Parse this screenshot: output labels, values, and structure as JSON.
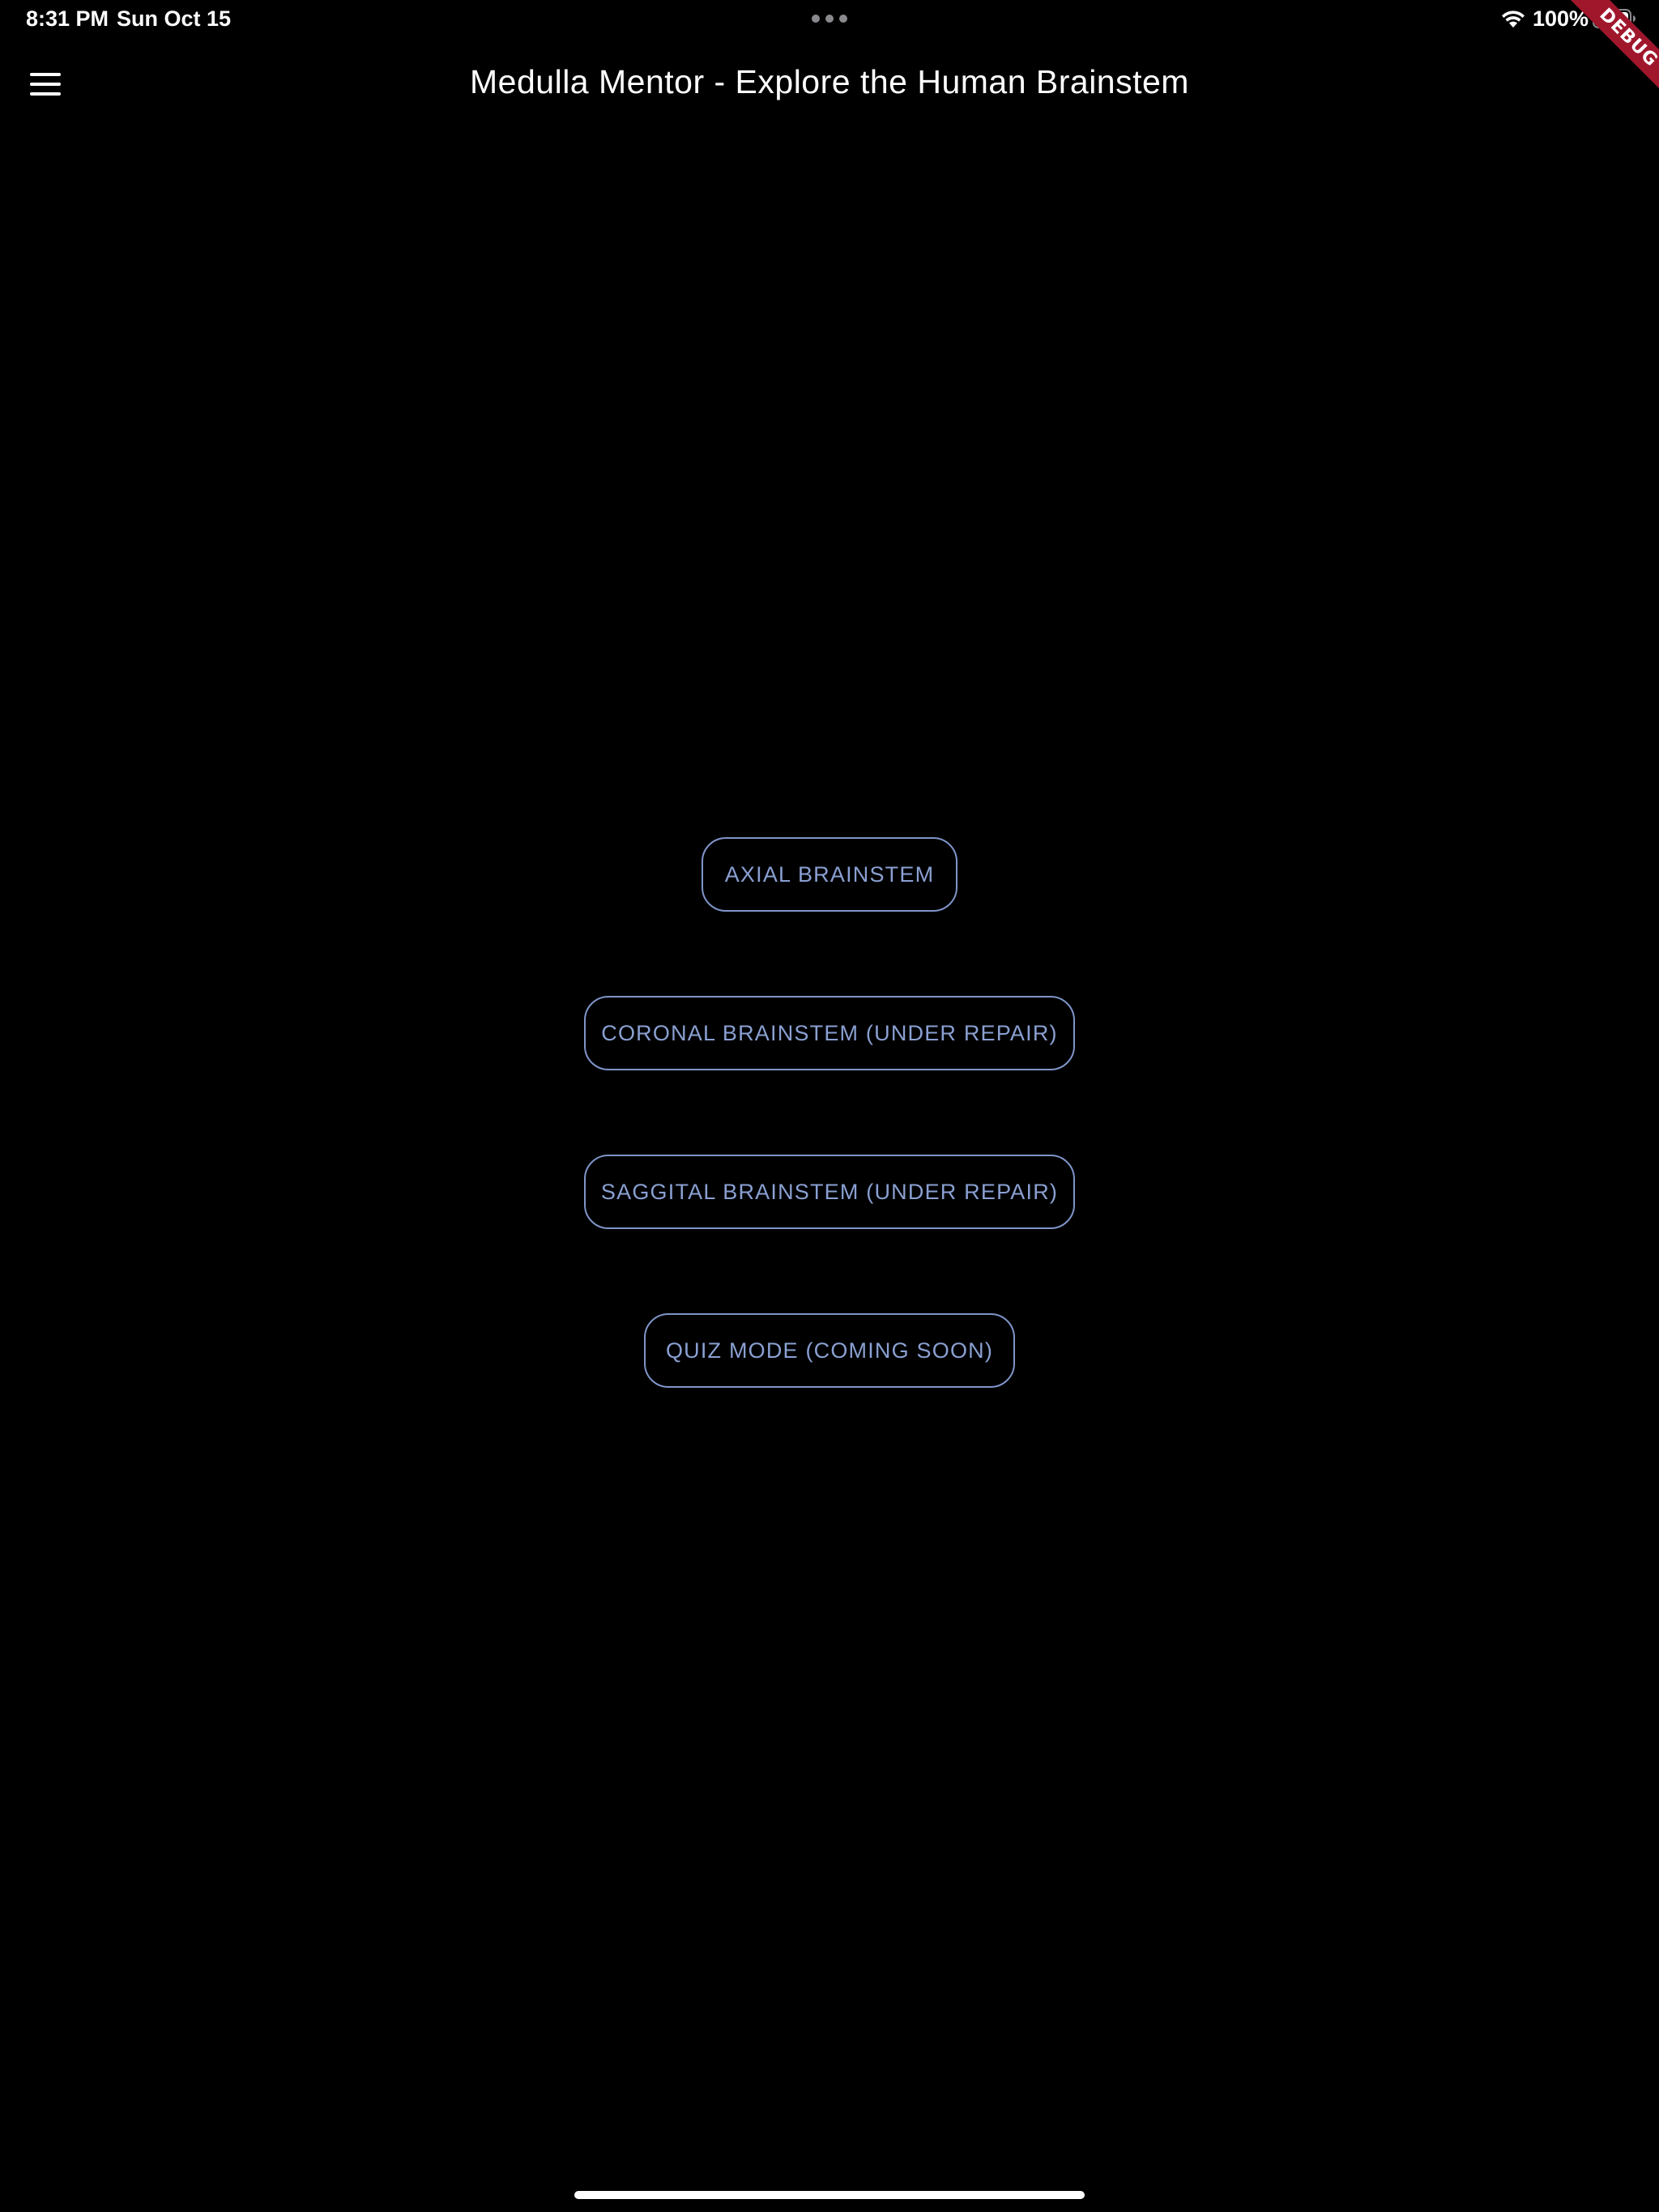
{
  "status_bar": {
    "time": "8:31 PM",
    "date": "Sun Oct 15",
    "battery_percent": "100%",
    "wifi_icon": "wifi-icon",
    "battery_icon": "battery-icon",
    "battery_level": 1.0
  },
  "debug_banner": {
    "label": "DEBUG",
    "color": "#a0172c"
  },
  "app_bar": {
    "menu_icon": "hamburger-menu-icon",
    "title": "Medulla Mentor - Explore the Human Brainstem"
  },
  "menu": {
    "buttons": [
      {
        "label": "AXIAL BRAINSTEM"
      },
      {
        "label": "CORONAL BRAINSTEM (UNDER REPAIR)"
      },
      {
        "label": "SAGGITAL BRAINSTEM (UNDER REPAIR)"
      },
      {
        "label": "QUIZ MODE (COMING SOON)"
      }
    ]
  },
  "theme": {
    "background": "#000000",
    "button_border": "#7f95c9",
    "button_text": "#8aa0d2",
    "title_text": "#ffffff"
  }
}
